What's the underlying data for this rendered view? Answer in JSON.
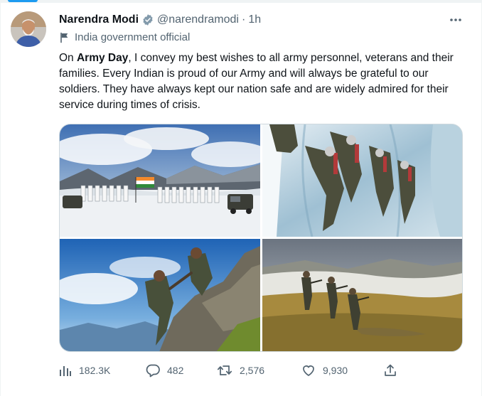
{
  "tweet": {
    "author": {
      "display_name": "Narendra Modi",
      "handle": "@narendramodi",
      "verified": true
    },
    "separator": "·",
    "timestamp": "1h",
    "account_label": "India government official",
    "text": {
      "intro": "On ",
      "bold_phrase": "Army Day",
      "rest": ", I convey my best wishes to all army personnel, veterans and their families. Every Indian is proud of our Army and will always be grateful to our soldiers. They have always kept our nation safe and are widely admired for their service during times of crisis."
    },
    "media": [
      {
        "icon": "photo-snow-parade-flag"
      },
      {
        "icon": "photo-ice-wall-climb"
      },
      {
        "icon": "photo-rock-climb-help"
      },
      {
        "icon": "photo-field-patrol"
      }
    ],
    "metrics": {
      "views": "182.3K",
      "replies": "482",
      "retweets": "2,576",
      "likes": "9,930"
    }
  },
  "colors": {
    "accent": "#1d9bf0",
    "text_primary": "#0f1419",
    "text_secondary": "#536471",
    "border": "#cfd9de"
  }
}
